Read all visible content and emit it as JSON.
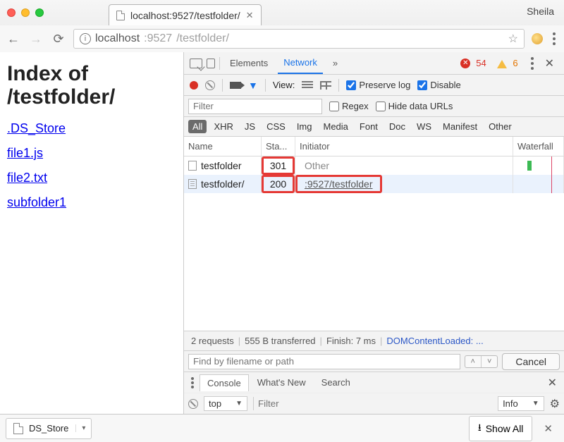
{
  "profile_name": "Sheila",
  "tab": {
    "title": "localhost:9527/testfolder/"
  },
  "url": {
    "host": "localhost",
    "port": ":9527",
    "path": "/testfolder/"
  },
  "page": {
    "heading": "Index of /testfolder/",
    "links": [
      ".DS_Store",
      "file1.js",
      "file2.txt",
      "subfolder1"
    ]
  },
  "devtools": {
    "tabs": {
      "elements": "Elements",
      "network": "Network",
      "more": "»"
    },
    "errors": "54",
    "warnings": "6",
    "toolbar": {
      "view_label": "View:",
      "preserve": "Preserve log",
      "disable": "Disable"
    },
    "filter_placeholder": "Filter",
    "regex_label": "Regex",
    "hide_urls_label": "Hide data URLs",
    "types": [
      "All",
      "XHR",
      "JS",
      "CSS",
      "Img",
      "Media",
      "Font",
      "Doc",
      "WS",
      "Manifest",
      "Other"
    ],
    "columns": {
      "name": "Name",
      "status": "Sta...",
      "initiator": "Initiator",
      "waterfall": "Waterfall"
    },
    "rows": [
      {
        "name": "testfolder",
        "status": "301",
        "initiator": "Other",
        "initiator_link": false
      },
      {
        "name": "testfolder/",
        "status": "200",
        "initiator": ":9527/testfolder",
        "initiator_link": true
      }
    ],
    "status_bar": {
      "requests": "2 requests",
      "transferred": "555 B transferred",
      "finish": "Finish: 7 ms",
      "dcl": "DOMContentLoaded: ..."
    },
    "find_placeholder": "Find by filename or path",
    "cancel": "Cancel",
    "drawer_tabs": {
      "console": "Console",
      "whatsnew": "What's New",
      "search": "Search"
    },
    "console": {
      "context": "top",
      "filter_placeholder": "Filter",
      "level": "Info"
    }
  },
  "shelf": {
    "download_name": "DS_Store",
    "show_all": "Show All"
  }
}
